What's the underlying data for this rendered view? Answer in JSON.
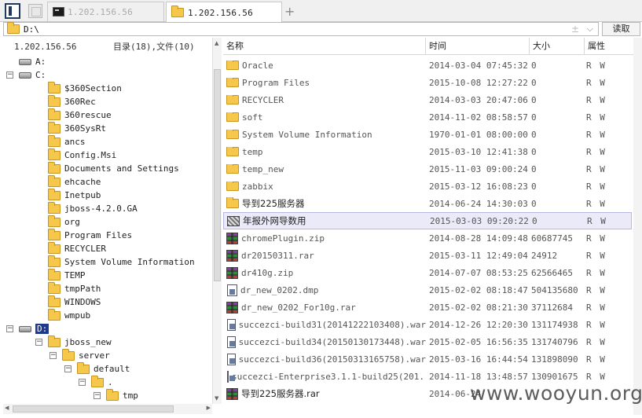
{
  "tabs": [
    {
      "label": "1.202.156.56",
      "icon": "terminal-icon",
      "active": false
    },
    {
      "label": "1.202.156.56",
      "icon": "folder-icon",
      "active": true
    }
  ],
  "path": {
    "value": "D:\\",
    "read_button": "读取"
  },
  "left": {
    "host": "1.202.156.56",
    "summary": "目录(18),文件(10)",
    "tree": [
      {
        "label": "A:",
        "kind": "drive",
        "level": 0,
        "expander": ""
      },
      {
        "label": "C:",
        "kind": "drive",
        "level": 0,
        "expander": "−"
      },
      {
        "label": "$360Section",
        "kind": "folder",
        "level": 1,
        "expander": ""
      },
      {
        "label": "360Rec",
        "kind": "folder",
        "level": 1,
        "expander": ""
      },
      {
        "label": "360rescue",
        "kind": "folder",
        "level": 1,
        "expander": ""
      },
      {
        "label": "360SysRt",
        "kind": "folder",
        "level": 1,
        "expander": ""
      },
      {
        "label": "ancs",
        "kind": "folder",
        "level": 1,
        "expander": ""
      },
      {
        "label": "Config.Msi",
        "kind": "folder",
        "level": 1,
        "expander": ""
      },
      {
        "label": "Documents and Settings",
        "kind": "folder",
        "level": 1,
        "expander": ""
      },
      {
        "label": "ehcache",
        "kind": "folder",
        "level": 1,
        "expander": ""
      },
      {
        "label": "Inetpub",
        "kind": "folder",
        "level": 1,
        "expander": ""
      },
      {
        "label": "jboss-4.2.0.GA",
        "kind": "folder",
        "level": 1,
        "expander": ""
      },
      {
        "label": "org",
        "kind": "folder",
        "level": 1,
        "expander": ""
      },
      {
        "label": "Program Files",
        "kind": "folder",
        "level": 1,
        "expander": ""
      },
      {
        "label": "RECYCLER",
        "kind": "folder",
        "level": 1,
        "expander": ""
      },
      {
        "label": "System Volume Information",
        "kind": "folder",
        "level": 1,
        "expander": ""
      },
      {
        "label": "TEMP",
        "kind": "folder",
        "level": 1,
        "expander": ""
      },
      {
        "label": "tmpPath",
        "kind": "folder",
        "level": 1,
        "expander": ""
      },
      {
        "label": "WINDOWS",
        "kind": "folder",
        "level": 1,
        "expander": ""
      },
      {
        "label": "wmpub",
        "kind": "folder",
        "level": 1,
        "expander": ""
      },
      {
        "label": "D:",
        "kind": "drive",
        "level": 0,
        "expander": "−",
        "selected": true
      },
      {
        "label": "jboss_new",
        "kind": "folder",
        "level": 1,
        "expander": "−"
      },
      {
        "label": "server",
        "kind": "folder",
        "level": 2,
        "expander": "−"
      },
      {
        "label": "default",
        "kind": "folder",
        "level": 3,
        "expander": "−"
      },
      {
        "label": ".",
        "kind": "folder",
        "level": 4,
        "expander": "−"
      },
      {
        "label": "tmp",
        "kind": "folder",
        "level": 5,
        "expander": "−"
      }
    ]
  },
  "columns": {
    "name": "名称",
    "time": "时间",
    "size": "大小",
    "attr": "属性"
  },
  "files": [
    {
      "name": "Oracle",
      "icon": "folder",
      "time": "2014-03-04 07:45:32",
      "size": "0",
      "attr": "R W"
    },
    {
      "name": "Program Files",
      "icon": "folder",
      "time": "2015-10-08 12:27:22",
      "size": "0",
      "attr": "R W"
    },
    {
      "name": "RECYCLER",
      "icon": "folder",
      "time": "2014-03-03 20:47:06",
      "size": "0",
      "attr": "R W"
    },
    {
      "name": "soft",
      "icon": "folder",
      "time": "2014-11-02 08:58:57",
      "size": "0",
      "attr": "R W"
    },
    {
      "name": "System Volume Information",
      "icon": "folder",
      "time": "1970-01-01 08:00:00",
      "size": "0",
      "attr": "R W"
    },
    {
      "name": "temp",
      "icon": "folder",
      "time": "2015-03-10 12:41:38",
      "size": "0",
      "attr": "R W"
    },
    {
      "name": "temp_new",
      "icon": "folder",
      "time": "2015-11-03 09:00:24",
      "size": "0",
      "attr": "R W"
    },
    {
      "name": "zabbix",
      "icon": "folder",
      "time": "2015-03-12 16:08:23",
      "size": "0",
      "attr": "R W"
    },
    {
      "name": "导到225服务器",
      "icon": "folder",
      "time": "2014-06-24 14:30:03",
      "size": "0",
      "attr": "R W"
    },
    {
      "name": "年报外网导数用",
      "icon": "archive",
      "time": "2015-03-03 09:20:22",
      "size": "0",
      "attr": "R W",
      "selected": true
    },
    {
      "name": "chromePlugin.zip",
      "icon": "zip",
      "time": "2014-08-28 14:09:48",
      "size": "60687745",
      "attr": "R W"
    },
    {
      "name": "dr20150311.rar",
      "icon": "zip",
      "time": "2015-03-11 12:49:04",
      "size": "24912",
      "attr": "R W"
    },
    {
      "name": "dr410g.zip",
      "icon": "zip",
      "time": "2014-07-07 08:53:25",
      "size": "62566465",
      "attr": "R W"
    },
    {
      "name": "dr_new_0202.dmp",
      "icon": "doc",
      "time": "2015-02-02 08:18:47",
      "size": "504135680",
      "attr": "R W"
    },
    {
      "name": "dr_new_0202_For10g.rar",
      "icon": "zip",
      "time": "2015-02-02 08:21:30",
      "size": "37112684",
      "attr": "R W"
    },
    {
      "name": "succezci-build31(20141222103408).war",
      "icon": "doc",
      "time": "2014-12-26 12:20:30",
      "size": "131174938",
      "attr": "R W"
    },
    {
      "name": "succezci-build34(20150130173448).war",
      "icon": "doc",
      "time": "2015-02-05 16:56:35",
      "size": "131740796",
      "attr": "R W"
    },
    {
      "name": "succezci-build36(20150313165758).war",
      "icon": "doc",
      "time": "2015-03-16 16:44:54",
      "size": "131898090",
      "attr": "R W"
    },
    {
      "name": "succezci-Enterprise3.1.1-build25(201...",
      "icon": "doc",
      "time": "2014-11-18 13:48:57",
      "size": "130901675",
      "attr": "R W"
    },
    {
      "name": "导到225服务器.rar",
      "icon": "zip",
      "time": "2014-06-24",
      "size": "",
      "attr": ""
    }
  ],
  "watermark": "www.wooyun.org"
}
